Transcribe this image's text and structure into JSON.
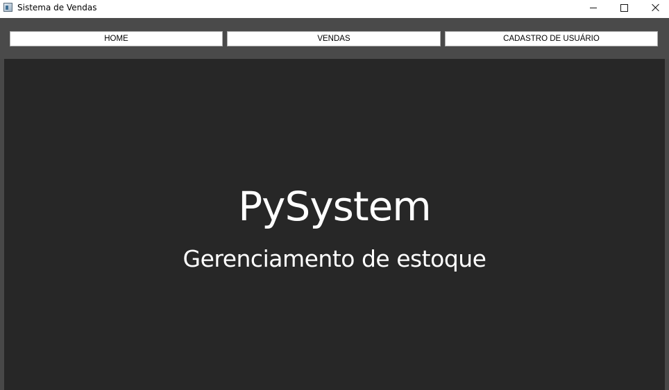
{
  "window": {
    "title": "Sistema de Vendas"
  },
  "icons": {
    "app": "app-window-icon",
    "minimize": "minimize-icon",
    "maximize": "maximize-icon",
    "close": "close-icon"
  },
  "nav": {
    "items": [
      {
        "label": "HOME"
      },
      {
        "label": "VENDAS"
      },
      {
        "label": "CADASTRO DE USUÁRIO"
      }
    ]
  },
  "hero": {
    "title": "PySystem",
    "subtitle": "Gerenciamento de estoque"
  },
  "colors": {
    "content_background": "#272727",
    "frame_background": "#484848",
    "nav_button_background": "#ffffff",
    "hero_text": "#ffffff"
  }
}
